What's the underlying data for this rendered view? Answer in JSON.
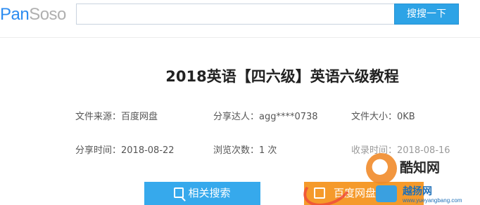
{
  "header": {
    "logo_pan": "Pan",
    "logo_soso": "Soso",
    "search_placeholder": "",
    "search_button": "搜搜一下"
  },
  "title": "2018英语【四六级】英语六级教程",
  "info": {
    "source": "文件来源：百度网盘",
    "sharer": "分享达人：agg****0738",
    "size": "文件大小：0KB",
    "share_time": "分享时间：2018-08-22",
    "views": "浏览次数：1 次",
    "collect_time": "收录时间：2018-08-16"
  },
  "buttons": {
    "related": "相关搜索",
    "baidu": "百度网盘"
  },
  "watermark": {
    "name": "酷知网",
    "site": "越扬网",
    "url": "www.yueyangbang.com"
  },
  "colors": {
    "primary_blue": "#2da3e6",
    "baidu_orange": "#f59a2b",
    "logo_blue": "#2d8cf0"
  }
}
